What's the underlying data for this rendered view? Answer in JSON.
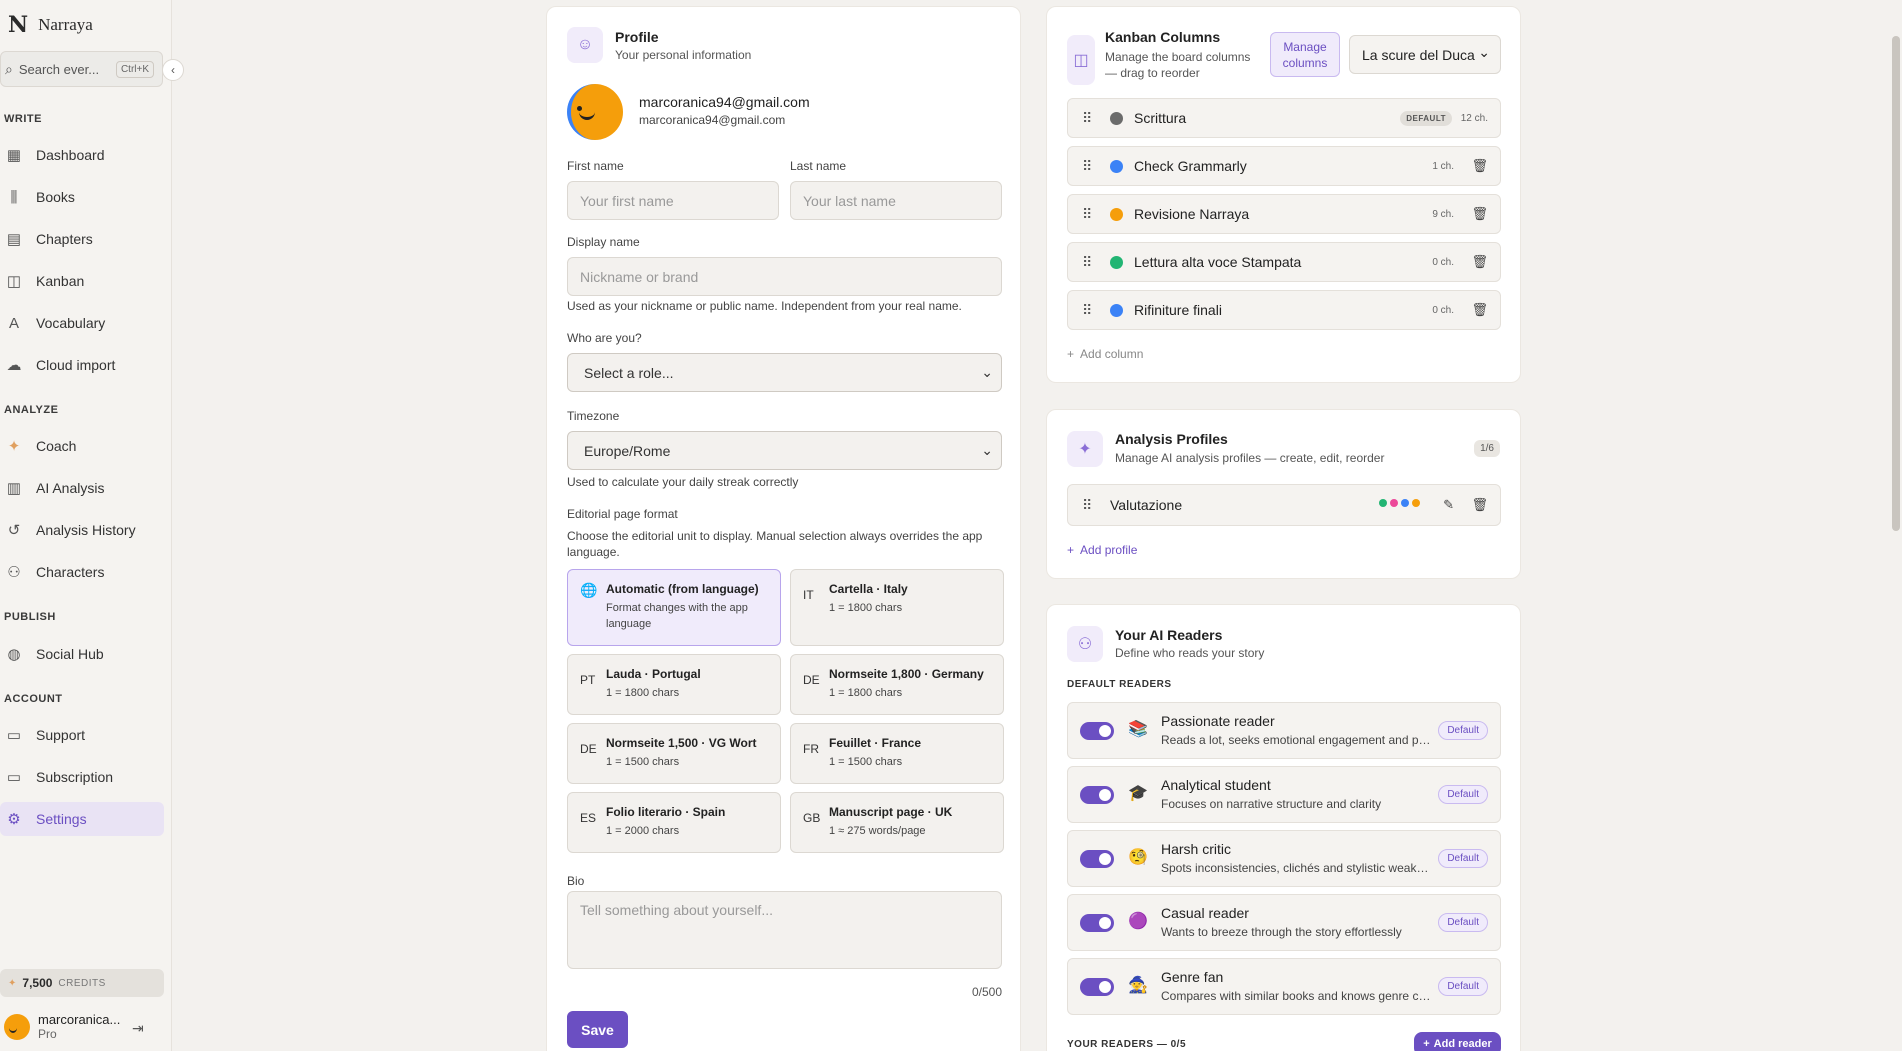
{
  "brand": {
    "logo": "N",
    "name": "Narraya"
  },
  "search": {
    "placeholder": "Search ever...",
    "shortcut": "Ctrl+K"
  },
  "nav": {
    "sections": {
      "write": "WRITE",
      "analyze": "ANALYZE",
      "publish": "PUBLISH",
      "account": "ACCOUNT"
    },
    "dashboard": "Dashboard",
    "books": "Books",
    "chapters": "Chapters",
    "kanban": "Kanban",
    "vocabulary": "Vocabulary",
    "cloud_import": "Cloud import",
    "coach": "Coach",
    "ai_analysis": "AI Analysis",
    "analysis_history": "Analysis History",
    "characters": "Characters",
    "social_hub": "Social Hub",
    "support": "Support",
    "subscription": "Subscription",
    "settings": "Settings"
  },
  "credits": {
    "amount": "7,500",
    "label": "CREDITS"
  },
  "user": {
    "name": "marcoranica...",
    "plan": "Pro"
  },
  "profile": {
    "title": "Profile",
    "subtitle": "Your personal information",
    "email_primary": "marcoranica94@gmail.com",
    "email_secondary": "marcoranica94@gmail.com",
    "first_name_label": "First name",
    "first_name_placeholder": "Your first name",
    "last_name_label": "Last name",
    "last_name_placeholder": "Your last name",
    "display_name_label": "Display name",
    "display_name_placeholder": "Nickname or brand",
    "display_name_help": "Used as your nickname or public name. Independent from your real name.",
    "role_label": "Who are you?",
    "role_value": "Select a role...",
    "timezone_label": "Timezone",
    "timezone_value": "Europe/Rome",
    "timezone_help": "Used to calculate your daily streak correctly",
    "format_label": "Editorial page format",
    "format_help": "Choose the editorial unit to display. Manual selection always overrides the app language.",
    "formats": [
      {
        "code": "🌐",
        "title": "Automatic (from language)",
        "sub": "Format changes with the app language"
      },
      {
        "code": "IT",
        "title": "Cartella · Italy",
        "sub": "1 = 1800 chars"
      },
      {
        "code": "PT",
        "title": "Lauda · Portugal",
        "sub": "1 = 1800 chars"
      },
      {
        "code": "DE",
        "title": "Normseite 1,800 · Germany",
        "sub": "1 = 1800 chars"
      },
      {
        "code": "DE",
        "title": "Normseite 1,500 · VG Wort",
        "sub": "1 = 1500 chars"
      },
      {
        "code": "FR",
        "title": "Feuillet · France",
        "sub": "1 = 1500 chars"
      },
      {
        "code": "ES",
        "title": "Folio literario · Spain",
        "sub": "1 = 2000 chars"
      },
      {
        "code": "GB",
        "title": "Manuscript page · UK",
        "sub": "1 ≈ 275 words/page"
      }
    ],
    "bio_label": "Bio",
    "bio_placeholder": "Tell something about yourself...",
    "bio_count": "0/500",
    "save": "Save"
  },
  "kanban": {
    "title": "Kanban Columns",
    "subtitle": "Manage the board columns — drag to reorder",
    "manage_button": "Manage columns",
    "book_select": "La scure del Duca",
    "columns": [
      {
        "name": "Scrittura",
        "count": "12 ch.",
        "color": "#6b6b6b",
        "badge": "DEFAULT"
      },
      {
        "name": "Check Grammarly",
        "count": "1 ch.",
        "color": "#3b82f6"
      },
      {
        "name": "Revisione Narraya",
        "count": "9 ch.",
        "color": "#f59e0b"
      },
      {
        "name": "Lettura alta voce Stampata",
        "count": "0 ch.",
        "color": "#22b573"
      },
      {
        "name": "Rifiniture finali",
        "count": "0 ch.",
        "color": "#3b82f6"
      }
    ],
    "add_column": "Add column"
  },
  "analysis": {
    "title": "Analysis Profiles",
    "subtitle": "Manage AI analysis profiles — create, edit, reorder",
    "count": "1/6",
    "profiles": [
      {
        "name": "Valutazione",
        "dots": [
          "#22b573",
          "#ec4899",
          "#3b82f6",
          "#f59e0b"
        ]
      }
    ],
    "add_profile": "Add profile"
  },
  "readers": {
    "title": "Your AI Readers",
    "subtitle": "Define who reads your story",
    "default_label": "DEFAULT READERS",
    "items": [
      {
        "emoji": "📚",
        "name": "Passionate reader",
        "desc": "Reads a lot, seeks emotional engagement and pace",
        "badge": "Default"
      },
      {
        "emoji": "🎓",
        "name": "Analytical student",
        "desc": "Focuses on narrative structure and clarity",
        "badge": "Default"
      },
      {
        "emoji": "🧐",
        "name": "Harsh critic",
        "desc": "Spots inconsistencies, clichés and stylistic weakne...",
        "badge": "Default"
      },
      {
        "emoji": "🟣",
        "name": "Casual reader",
        "desc": "Wants to breeze through the story effortlessly",
        "badge": "Default"
      },
      {
        "emoji": "🧙",
        "name": "Genre fan",
        "desc": "Compares with similar books and knows genre con...",
        "badge": "Default"
      }
    ],
    "your_label": "YOUR READERS — 0/5",
    "add_reader": "Add reader"
  }
}
